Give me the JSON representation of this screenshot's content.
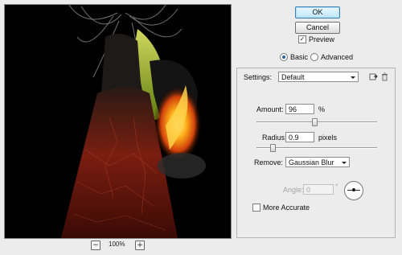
{
  "preview": {
    "zoom_out": "−",
    "zoom_in": "+",
    "zoom_level": "100%"
  },
  "buttons": {
    "ok": "OK",
    "cancel": "Cancel"
  },
  "preview_checkbox": {
    "label": "Preview",
    "checked": true
  },
  "mode": {
    "basic": "Basic",
    "advanced": "Advanced",
    "selected": "Basic"
  },
  "settings": {
    "label": "Settings:",
    "value": "Default"
  },
  "amount": {
    "label": "Amount:",
    "value": "96",
    "unit": "%",
    "level": 0.48
  },
  "radius": {
    "label": "Radius:",
    "value": "0.9",
    "unit": "pixels",
    "level": 0.12
  },
  "remove": {
    "label": "Remove:",
    "value": "Gaussian Blur"
  },
  "angle": {
    "label": "Angle:",
    "value": "0",
    "unit": "°"
  },
  "more_accurate": {
    "label": "More Accurate",
    "checked": false
  },
  "icons": {
    "save": "save-settings-icon",
    "delete": "trash-icon"
  },
  "colors": {
    "accent": "#2a5fa5",
    "ok_border": "#3c7fb1"
  }
}
